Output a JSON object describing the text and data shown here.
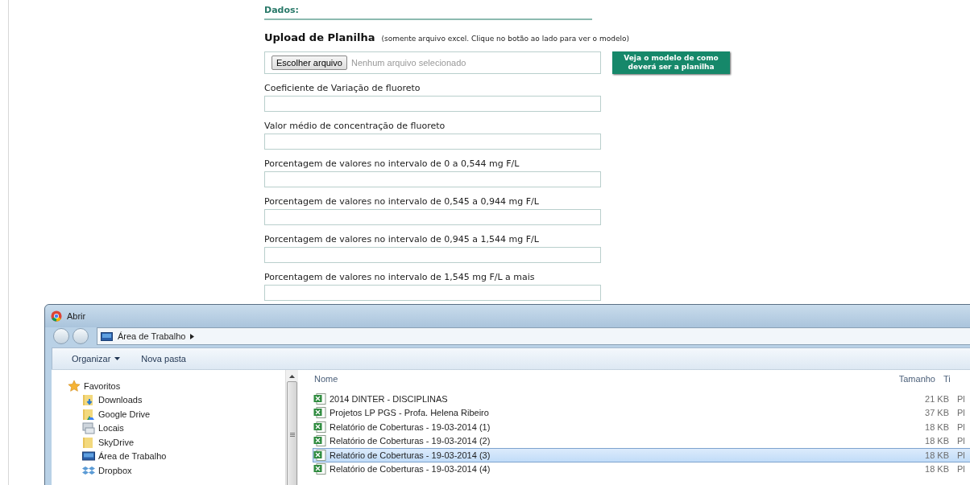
{
  "page": {
    "section_title": "Dados:",
    "upload": {
      "title": "Upload de Planilha",
      "hint": "(somente arquivo excel. Clique no botão ao lado para ver o modelo)",
      "choose_button": "Escolher arquivo",
      "file_status": "Nenhum arquivo selecionado",
      "model_button": "Veja o modelo de como\ndeverá ser a planilha"
    },
    "fields": [
      {
        "label": "Coeficiente de Variação de fluoreto"
      },
      {
        "label": "Valor médio de concentração de fluoreto"
      },
      {
        "label": "Porcentagem de valores no intervalo de 0 a 0,544 mg F/L"
      },
      {
        "label": "Porcentagem de valores no intervalo de 0,545 a 0,944 mg F/L"
      },
      {
        "label": "Porcentagem de valores no intervalo de 0,945 a 1,544 mg F/L"
      },
      {
        "label": "Porcentagem de valores no intervalo de 1,545 mg F/L a mais"
      }
    ]
  },
  "dialog": {
    "title": "Abrir",
    "breadcrumb": "Área de Trabalho",
    "toolbar": [
      {
        "label": "Organizar",
        "dropdown": true
      },
      {
        "label": "Nova pasta",
        "dropdown": false
      }
    ],
    "sidebar": {
      "group": "Favoritos",
      "items": [
        {
          "label": "Downloads",
          "kind": "downloads"
        },
        {
          "label": "Google Drive",
          "kind": "drive"
        },
        {
          "label": "Locais",
          "kind": "places"
        },
        {
          "label": "SkyDrive",
          "kind": "folder"
        },
        {
          "label": "Área de Trabalho",
          "kind": "desktop"
        },
        {
          "label": "Dropbox",
          "kind": "dropbox"
        }
      ]
    },
    "columns": [
      "Nome",
      "Tamanho",
      "Ti"
    ],
    "files": [
      {
        "name": "2014 DINTER - DISCIPLINAS",
        "size": "21 KB",
        "type": "Pl",
        "selected": false
      },
      {
        "name": "Projetos LP PGS - Profa. Helena Ribeiro",
        "size": "37 KB",
        "type": "Pl",
        "selected": false
      },
      {
        "name": "Relatório de Coberturas - 19-03-2014 (1)",
        "size": "18 KB",
        "type": "Pl",
        "selected": false
      },
      {
        "name": "Relatório de Coberturas - 19-03-2014 (2)",
        "size": "18 KB",
        "type": "Pl",
        "selected": false
      },
      {
        "name": "Relatório de Coberturas - 19-03-2014 (3)",
        "size": "18 KB",
        "type": "Pl",
        "selected": true
      },
      {
        "name": "Relatório de Coberturas - 19-03-2014 (4)",
        "size": "18 KB",
        "type": "Pl",
        "selected": false
      }
    ]
  }
}
